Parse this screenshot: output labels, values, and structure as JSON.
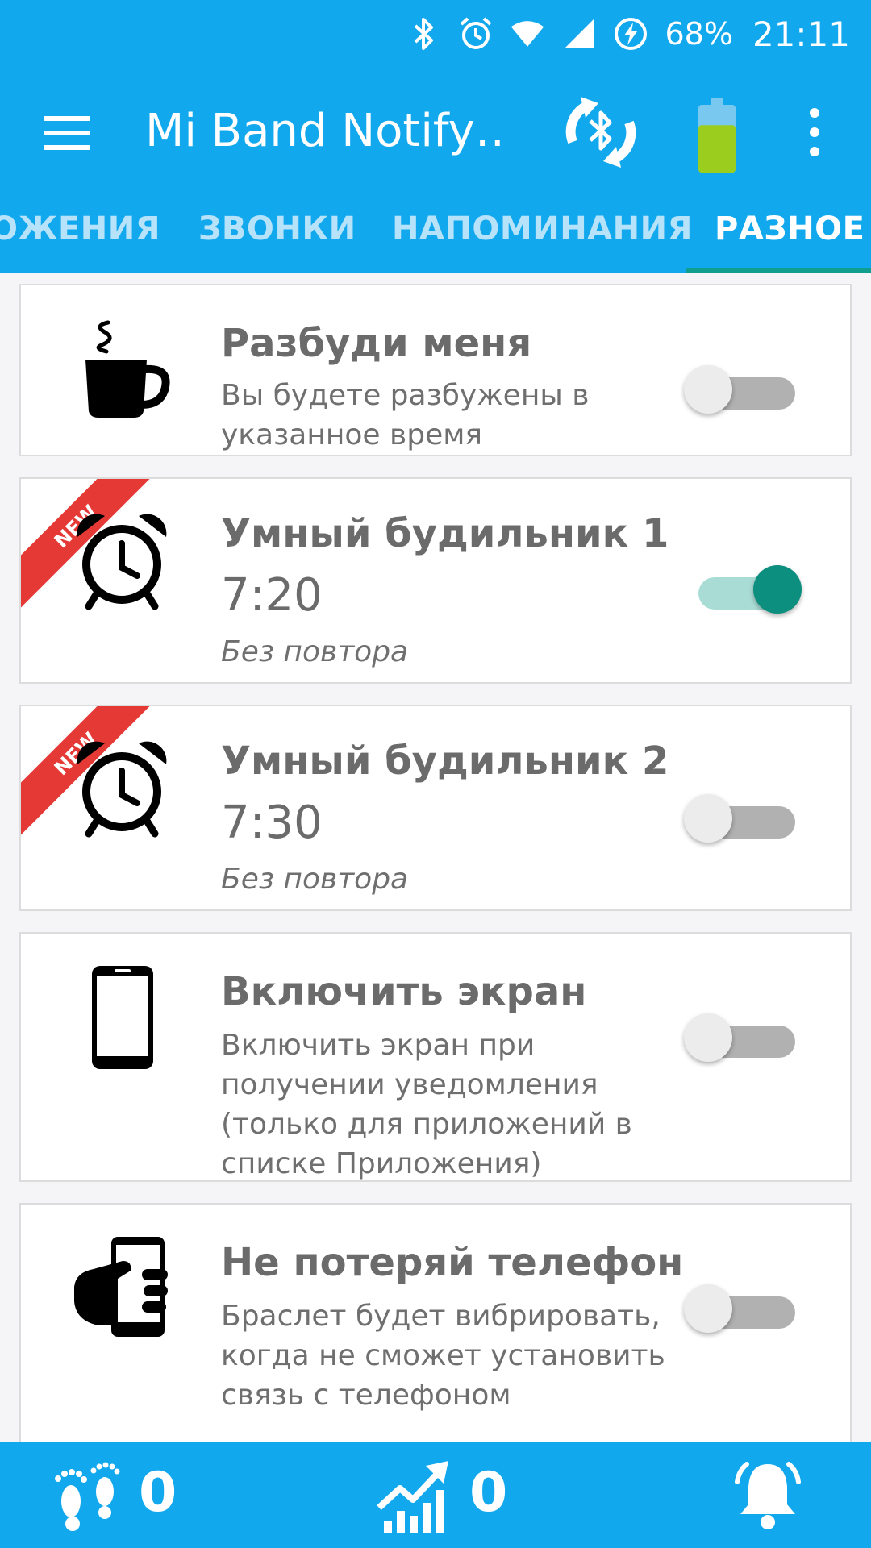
{
  "status_bar": {
    "battery_percent": "68%",
    "time": "21:11",
    "icons": [
      "bluetooth-icon",
      "alarm-icon",
      "wifi-icon",
      "signal-icon",
      "charging-icon"
    ]
  },
  "toolbar": {
    "title": "Mi Band Notify…",
    "battery_level": 0.7,
    "colors": {
      "bar": "#12a8ee",
      "battery_fill": "#9acd1e"
    }
  },
  "tabs": [
    {
      "label": "ОЖЕНИЯ",
      "active": false
    },
    {
      "label": "ЗВОНКИ",
      "active": false
    },
    {
      "label": "НАПОМИНАНИЯ",
      "active": false
    },
    {
      "label": "РАЗНОЕ",
      "active": true
    }
  ],
  "cards": [
    {
      "title": "Разбуди меня",
      "description": "Вы будете разбужены в указанное время",
      "icon": "coffee-cup-icon",
      "enabled": false
    },
    {
      "title": "Умный будильник 1",
      "time": "7:20",
      "repeat": "Без повтора",
      "badge": "NEW",
      "icon": "alarm-clock-icon",
      "enabled": true
    },
    {
      "title": "Умный будильник 2",
      "time": "7:30",
      "repeat": "Без повтора",
      "badge": "NEW",
      "icon": "alarm-clock-icon",
      "enabled": false
    },
    {
      "title": "Включить экран",
      "description": "Включить экран при получении уведомления (только для приложений в списке Приложения)",
      "icon": "smartphone-icon",
      "enabled": false
    },
    {
      "title": "Не потеряй телефон",
      "description": "Браслет будет вибрировать, когда не сможет установить связь с телефоном",
      "icon": "hand-phone-icon",
      "enabled": false
    }
  ],
  "bottom_bar": {
    "steps": "0",
    "activity": "0",
    "icons": [
      "footprints-icon",
      "chart-up-icon",
      "bell-icon"
    ]
  },
  "colors": {
    "toggle_on_thumb": "#0c8f7e",
    "toggle_on_track": "#aadcd6",
    "badge": "#e53935"
  }
}
